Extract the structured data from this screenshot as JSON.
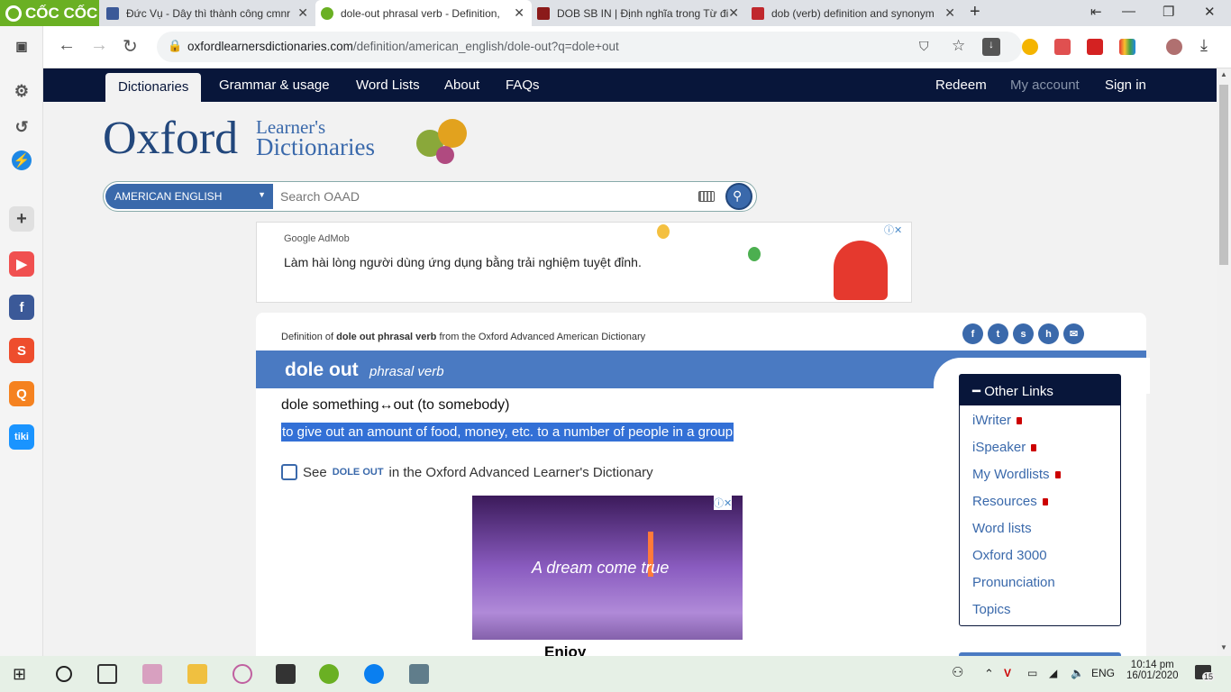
{
  "browser": {
    "brand": "CỐC CỐC",
    "tabs": [
      {
        "title": "Đức Vụ - Dây thì thành công cmnr",
        "color": "#3b5998"
      },
      {
        "title": "dole-out phrasal verb - Definition,",
        "color": "#6ab023"
      },
      {
        "title": "DOB SB IN | Định nghĩa trong Từ đi",
        "color": "#8b1a1a"
      },
      {
        "title": "dob (verb) definition and synonym",
        "color": "#c0282d"
      }
    ],
    "url_host": "oxfordlearnersdictionaries.com",
    "url_path": "/definition/american_english/dole-out?q=dole+out"
  },
  "site": {
    "nav": [
      "Dictionaries",
      "Grammar & usage",
      "Word Lists",
      "About",
      "FAQs"
    ],
    "nav_right": {
      "redeem": "Redeem",
      "account": "My account",
      "signin": "Sign in"
    },
    "logo_oxford": "Oxford",
    "logo_learners": "Learner's",
    "logo_dictionaries": "Dictionaries",
    "search_lang": "AMERICAN ENGLISH",
    "search_placeholder": "Search OAAD"
  },
  "ad1": {
    "brand": "Google AdMob",
    "text": "Làm hài lòng người dùng ứng dụng bằng trải nghiệm tuyệt đỉnh."
  },
  "entry": {
    "def_pre": "Definition of ",
    "def_word": "dole out phrasal verb",
    "def_post": " from the Oxford Advanced American Dictionary",
    "headword": "dole out",
    "pos": "phrasal verb",
    "phrase": "dole something↔out (to somebody)",
    "sense": "to give out an amount of food, money, etc. to a number of people in a group",
    "see_pre": "See",
    "see_link": "DOLE OUT",
    "see_post": "in the Oxford Advanced Learner's Dictionary"
  },
  "ad2": {
    "text": "A dream come true",
    "foot": "Enjoy"
  },
  "other_links": {
    "title": "Other Links",
    "items": [
      "iWriter",
      "iSpeaker",
      "My Wordlists",
      "Resources",
      "Word lists",
      "Oxford 3000",
      "Pronunciation",
      "Topics"
    ]
  },
  "taskbar": {
    "lang": "ENG",
    "time": "10:14 pm",
    "date": "16/01/2020",
    "notif": "15"
  }
}
